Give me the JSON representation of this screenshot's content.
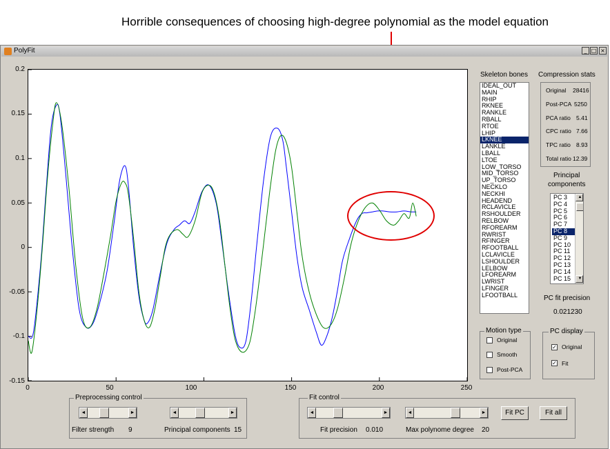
{
  "caption": "Horrible consequences of choosing high-degree polynomial as the model equation",
  "window": {
    "title": "PolyFit",
    "minimize_glyph": "_",
    "maximize_glyph": "□",
    "close_glyph": "×"
  },
  "chart_data": {
    "type": "line",
    "xlim": [
      0,
      250
    ],
    "ylim": [
      -0.15,
      0.2
    ],
    "x_ticks": [
      "0",
      "50",
      "100",
      "150",
      "200",
      "250"
    ],
    "y_ticks": [
      "0.2",
      "0.15",
      "0.1",
      "0.05",
      "0",
      "-0.05",
      "-0.1",
      "-0.15"
    ],
    "grid": false,
    "series": [
      {
        "color": "#0000ff",
        "x": [
          0,
          3,
          7,
          10,
          13,
          16,
          18,
          21,
          25,
          29,
          33,
          37,
          41,
          45,
          49,
          52,
          55,
          57,
          60,
          63,
          66,
          68,
          71,
          75,
          79,
          83,
          86,
          89,
          92,
          95,
          99,
          103,
          107,
          110,
          114,
          118,
          121,
          124,
          127,
          130,
          134,
          138,
          142,
          145,
          147,
          150,
          153,
          156,
          160,
          164,
          167,
          170,
          173,
          176,
          179,
          183,
          187,
          190,
          193,
          196,
          199,
          202,
          206,
          210,
          214,
          218,
          221
        ],
        "y": [
          -0.1,
          -0.095,
          -0.02,
          0.06,
          0.135,
          0.16,
          0.15,
          0.09,
          0.0,
          -0.07,
          -0.09,
          -0.085,
          -0.06,
          -0.025,
          0.03,
          0.075,
          0.092,
          0.07,
          0.0,
          -0.055,
          -0.082,
          -0.085,
          -0.07,
          -0.03,
          0.005,
          0.02,
          0.025,
          0.03,
          0.027,
          0.04,
          0.063,
          0.07,
          0.05,
          0.01,
          -0.05,
          -0.1,
          -0.113,
          -0.105,
          -0.06,
          0.0,
          0.075,
          0.125,
          0.134,
          0.12,
          0.09,
          0.04,
          -0.01,
          -0.045,
          -0.07,
          -0.095,
          -0.11,
          -0.1,
          -0.08,
          -0.05,
          -0.015,
          0.01,
          0.03,
          0.038,
          0.039,
          0.04,
          0.041,
          0.041,
          0.04,
          0.04,
          0.041,
          0.04,
          0.04
        ]
      },
      {
        "color": "#008000",
        "x": [
          0,
          2,
          5,
          8,
          11,
          14,
          16,
          19,
          23,
          27,
          31,
          35,
          39,
          43,
          47,
          50,
          53,
          55,
          57,
          60,
          63,
          66,
          69,
          72,
          75,
          78,
          81,
          85,
          88,
          91,
          95,
          99,
          103,
          106,
          109,
          112,
          115,
          118,
          122,
          126,
          129,
          132,
          135,
          138,
          141,
          144,
          147,
          150,
          153,
          156,
          160,
          164,
          168,
          172,
          176,
          180,
          184,
          188,
          192,
          196,
          200,
          204,
          208,
          211,
          214,
          217,
          219,
          221
        ],
        "y": [
          -0.105,
          -0.118,
          -0.07,
          0.0,
          0.08,
          0.14,
          0.163,
          0.14,
          0.07,
          -0.02,
          -0.08,
          -0.09,
          -0.07,
          -0.03,
          0.015,
          0.052,
          0.072,
          0.073,
          0.06,
          0.01,
          -0.05,
          -0.082,
          -0.09,
          -0.07,
          -0.035,
          0.0,
          0.015,
          0.02,
          0.015,
          0.012,
          0.03,
          0.062,
          0.07,
          0.06,
          0.03,
          -0.02,
          -0.07,
          -0.105,
          -0.118,
          -0.108,
          -0.075,
          -0.03,
          0.02,
          0.07,
          0.11,
          0.126,
          0.118,
          0.09,
          0.04,
          -0.01,
          -0.05,
          -0.075,
          -0.09,
          -0.088,
          -0.07,
          -0.035,
          0.005,
          0.03,
          0.045,
          0.05,
          0.042,
          0.03,
          0.025,
          0.03,
          0.038,
          0.033,
          0.05,
          0.035
        ]
      }
    ],
    "annotation": {
      "type": "ellipse",
      "color": "#e00000",
      "x_range": [
        182,
        232
      ],
      "y_range": [
        0.007,
        0.063
      ]
    }
  },
  "skeleton": {
    "title": "Skeleton bones",
    "items": [
      "IDEAL_OUT",
      "MAIN",
      "RHIP",
      "RKNEE",
      "RANKLE",
      "RBALL",
      "RTOE",
      "LHIP",
      "LKNEE",
      "LANKLE",
      "LBALL",
      "LTOE",
      "LOW_TORSO",
      "MID_TORSO",
      "UP_TORSO",
      "NECKLO",
      "NECKHI",
      "HEADEND",
      "RCLAVICLE",
      "RSHOULDER",
      "RELBOW",
      "RFOREARM",
      "RWRIST",
      "RFINGER",
      "RFOOTBALL",
      "LCLAVICLE",
      "LSHOULDER",
      "LELBOW",
      "LFOREARM",
      "LWRIST",
      "LFINGER",
      "LFOOTBALL"
    ],
    "selected": "LKNEE"
  },
  "stats": {
    "title": "Compression stats",
    "rows": [
      {
        "label": "Original",
        "value": "28416"
      },
      {
        "label": "Post-PCA",
        "value": "5250"
      },
      {
        "label": "PCA ratio",
        "value": "5.41"
      },
      {
        "label": "CPC ratio",
        "value": "7.66"
      },
      {
        "label": "TPC ratio",
        "value": "8.93"
      },
      {
        "label": "Total ratio",
        "value": "12.39"
      }
    ]
  },
  "pc": {
    "title_line1": "Principal",
    "title_line2": "components",
    "items": [
      "PC 3",
      "PC 4",
      "PC 5",
      "PC 6",
      "PC 7",
      "PC 8",
      "PC 9",
      "PC 10",
      "PC 11",
      "PC 12",
      "PC 13",
      "PC 14",
      "PC 15"
    ],
    "selected": "PC 8",
    "precision_label": "PC fit precision",
    "precision_value": "0.021230"
  },
  "motion_type": {
    "title": "Motion type",
    "options": [
      {
        "label": "Original",
        "checked": false
      },
      {
        "label": "Smooth",
        "checked": false
      },
      {
        "label": "Post-PCA",
        "checked": false
      }
    ]
  },
  "pc_display": {
    "title": "PC display",
    "options": [
      {
        "label": "Original",
        "checked": true
      },
      {
        "label": "Fit",
        "checked": true
      }
    ]
  },
  "preprocessing": {
    "title": "Preprocessing control",
    "filter_label": "Filter strength",
    "filter_value": "9",
    "pc_label": "Principal components",
    "pc_value": "15"
  },
  "fit": {
    "title": "Fit control",
    "precision_label": "Fit precision",
    "precision_value": "0.010",
    "degree_label": "Max polynome degree",
    "degree_value": "20",
    "fit_pc_label": "Fit PC",
    "fit_all_label": "Fit all"
  },
  "glyphs": {
    "left": "◄",
    "right": "►",
    "up": "▲",
    "down": "▼",
    "check": "✓"
  }
}
